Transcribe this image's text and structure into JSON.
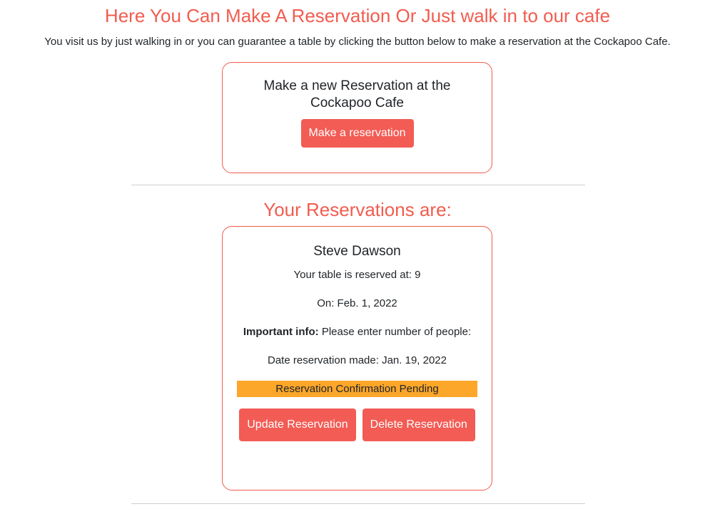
{
  "header": {
    "title": "Here You Can Make A Reservation Or Just walk in to our cafe",
    "intro": "You visit us by just walking in or you can guarantee a table by clicking the button below to make a reservation at the Cockapoo Cafe."
  },
  "new_reservation": {
    "heading": "Make a new Reservation at the Cockapoo Cafe",
    "button_label": "Make a reservation"
  },
  "reservations": {
    "title": "Your Reservations are:",
    "items": [
      {
        "name": "Steve Dawson",
        "table_text": "Your table is reserved at: 9",
        "date_text": "On: Feb. 1, 2022",
        "info_label": "Important info:",
        "info_text": " Please enter number of people:",
        "made_text": "Date reservation made: Jan. 19, 2022",
        "status": "Reservation Confirmation Pending",
        "update_label": "Update Reservation",
        "delete_label": "Delete Reservation"
      }
    ]
  },
  "colors": {
    "accent": "#f25c4f",
    "button": "#f25c55",
    "status_pending": "#fca62a"
  }
}
